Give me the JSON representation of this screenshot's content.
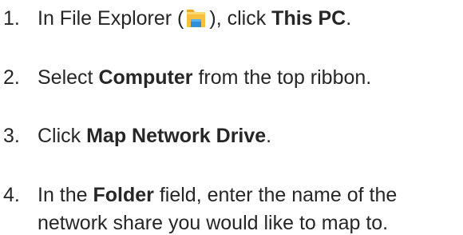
{
  "steps": [
    {
      "num": "1.",
      "pre": "In File Explorer (",
      "icon": "file-explorer-folder-icon",
      "mid": "), click ",
      "bold": "This PC",
      "post": "."
    },
    {
      "num": "2.",
      "pre": "Select ",
      "bold": "Computer",
      "post": " from the top ribbon."
    },
    {
      "num": "3.",
      "pre": "Click ",
      "bold": "Map Network Drive",
      "post": "."
    },
    {
      "num": "4.",
      "pre": "In the ",
      "bold": "Folder",
      "post": " field, enter the name of the",
      "line2": "network share you would like to map to."
    }
  ],
  "colors": {
    "text": "#262626",
    "folder_yellow": "#f5c040",
    "folder_blue": "#2f8fd8"
  }
}
